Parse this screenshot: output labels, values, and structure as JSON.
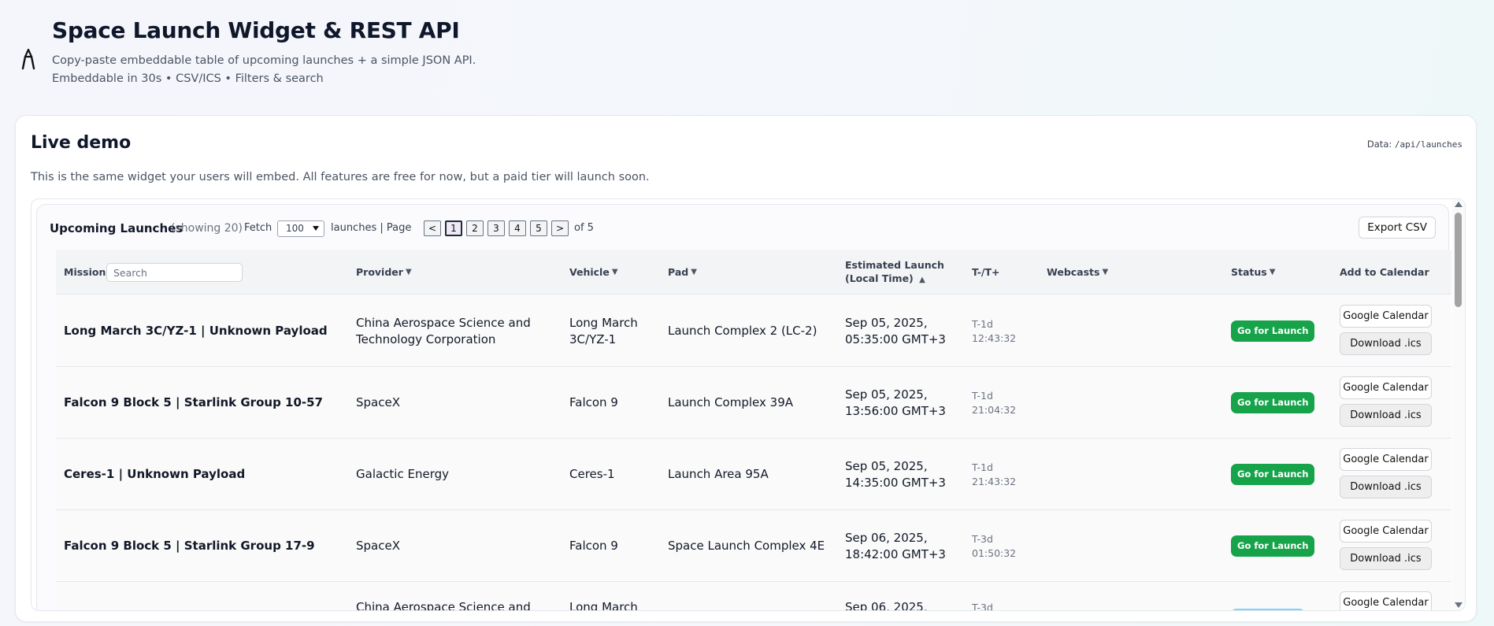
{
  "header": {
    "title": "Space Launch Widget & REST API",
    "subtitle": "Copy-paste embeddable table of upcoming launches + a simple JSON API.",
    "tagline": "Embeddable in 30s • CSV/ICS • Filters & search"
  },
  "demo": {
    "title": "Live demo",
    "data_label": "Data:",
    "data_path": "/api/launches",
    "description": "This is the same widget your users will embed. All features are free for now, but a paid tier will launch soon."
  },
  "widget": {
    "title": "Upcoming Launches",
    "showing": "(showing 20)",
    "fetch_label": "Fetch",
    "fetch_value": "100",
    "launches_page_label": "launches | Page",
    "prev": "<",
    "next": ">",
    "pages": [
      "1",
      "2",
      "3",
      "4",
      "5"
    ],
    "current_page": 1,
    "of_label": "of 5",
    "export_label": "Export CSV"
  },
  "columns": {
    "mission": "Mission",
    "search_placeholder": "Search",
    "provider": "Provider",
    "vehicle": "Vehicle",
    "pad": "Pad",
    "launch": "Estimated Launch (Local Time)",
    "tminus": "T-/T+",
    "webcasts": "Webcasts",
    "status": "Status",
    "calendar": "Add to Calendar",
    "sort_down": "▼",
    "sort_up": "▲"
  },
  "rows": [
    {
      "mission": "Long March 3C/YZ-1 | Unknown Payload",
      "provider": "China Aerospace Science and Technology Corporation",
      "vehicle": "Long March 3C/YZ-1",
      "pad": "Launch Complex 2 (LC-2)",
      "launch": "Sep 05, 2025, 05:35:00 GMT+3",
      "tminus_day": "T-1d",
      "tminus_time": "12:43:32",
      "status": "Go for Launch",
      "gcal": "Google Calendar",
      "ics": "Download .ics"
    },
    {
      "mission": "Falcon 9 Block 5 | Starlink Group 10-57",
      "provider": "SpaceX",
      "vehicle": "Falcon 9",
      "pad": "Launch Complex 39A",
      "launch": "Sep 05, 2025, 13:56:00 GMT+3",
      "tminus_day": "T-1d",
      "tminus_time": "21:04:32",
      "status": "Go for Launch",
      "gcal": "Google Calendar",
      "ics": "Download .ics"
    },
    {
      "mission": "Ceres-1 | Unknown Payload",
      "provider": "Galactic Energy",
      "vehicle": "Ceres-1",
      "pad": "Launch Area 95A",
      "launch": "Sep 05, 2025, 14:35:00 GMT+3",
      "tminus_day": "T-1d",
      "tminus_time": "21:43:32",
      "status": "Go for Launch",
      "gcal": "Google Calendar",
      "ics": "Download .ics"
    },
    {
      "mission": "Falcon 9 Block 5 | Starlink Group 17-9",
      "provider": "SpaceX",
      "vehicle": "Falcon 9",
      "pad": "Space Launch Complex 4E",
      "launch": "Sep 06, 2025, 18:42:00 GMT+3",
      "tminus_day": "T-3d",
      "tminus_time": "01:50:32",
      "status": "Go for Launch",
      "gcal": "Google Calendar",
      "ics": "Download .ics"
    },
    {
      "provider": "China Aerospace Science and",
      "vehicle": "Long March",
      "launch": "Sep 06, 2025,",
      "tminus_day": "T-3d",
      "gcal": "Google Calendar"
    }
  ],
  "colors": {
    "badge_go": "#16a34a",
    "badge_partial": "#7dd3fc",
    "active_page": "#ede9f6"
  },
  "icons": [
    "rocket-logo-icon",
    "scroll-up-icon",
    "scroll-down-icon",
    "select-caret-icon"
  ]
}
